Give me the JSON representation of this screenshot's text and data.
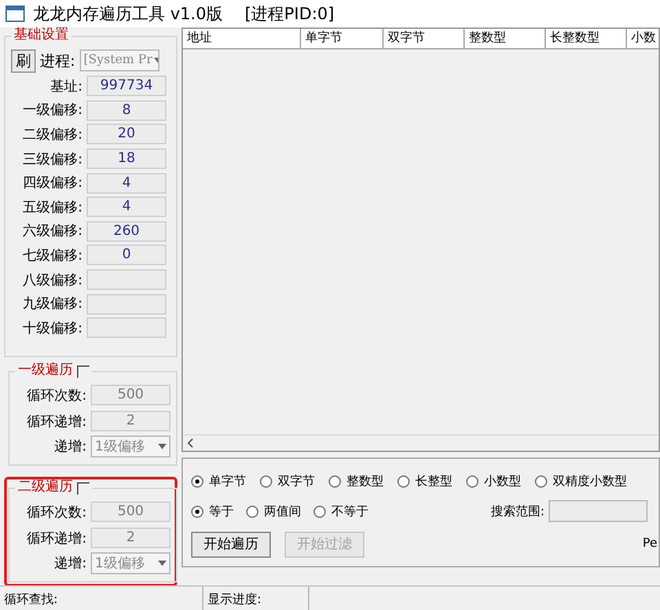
{
  "window": {
    "title": "龙龙内存遍历工具 v1.0版",
    "pid": "[进程PID:0]"
  },
  "base_settings": {
    "title": "基础设置",
    "refresh_button": "刷",
    "process_label": "进程:",
    "process_value": "[System Pr",
    "fields": [
      {
        "label": "基址:",
        "value": "997734"
      },
      {
        "label": "一级偏移:",
        "value": "8"
      },
      {
        "label": "二级偏移:",
        "value": "20"
      },
      {
        "label": "三级偏移:",
        "value": "18"
      },
      {
        "label": "四级偏移:",
        "value": "4"
      },
      {
        "label": "五级偏移:",
        "value": "4"
      },
      {
        "label": "六级偏移:",
        "value": "260"
      },
      {
        "label": "七级偏移:",
        "value": "0"
      },
      {
        "label": "八级偏移:"
      },
      {
        "label": "九级偏移:"
      },
      {
        "label": "十级偏移:"
      }
    ]
  },
  "loops": [
    {
      "title": "一级遍历",
      "checked": false,
      "highlighted": false,
      "fields": [
        {
          "label": "循环次数:",
          "value": "500"
        },
        {
          "label": "循环递增:",
          "value": "2"
        }
      ],
      "step_label": "递增:",
      "step_value": "1级偏移"
    },
    {
      "title": "二级遍历",
      "checked": false,
      "highlighted": true,
      "fields": [
        {
          "label": "循环次数:",
          "value": "500"
        },
        {
          "label": "循环递增:",
          "value": "2"
        }
      ],
      "step_label": "递增:",
      "step_value": "1级偏移"
    }
  ],
  "table": {
    "columns": [
      "地址",
      "单字节",
      "双字节",
      "整数型",
      "长整数型",
      "小数"
    ]
  },
  "type_options": [
    {
      "label": "单字节",
      "selected": true
    },
    {
      "label": "双字节",
      "selected": false
    },
    {
      "label": "整数型",
      "selected": false
    },
    {
      "label": "长整型",
      "selected": false
    },
    {
      "label": "小数型",
      "selected": false
    },
    {
      "label": "双精度小数型",
      "selected": false
    }
  ],
  "compare_options": [
    {
      "label": "等于",
      "selected": true
    },
    {
      "label": "两值间",
      "selected": false
    },
    {
      "label": "不等于",
      "selected": false
    }
  ],
  "search_range": {
    "label": "搜索范围:"
  },
  "buttons": [
    {
      "label": "开始遍历",
      "disabled": false
    },
    {
      "label": "开始过滤",
      "disabled": true
    }
  ],
  "cut_text": "Pe",
  "status_bar": [
    "循环查找:",
    "显示进度:"
  ]
}
